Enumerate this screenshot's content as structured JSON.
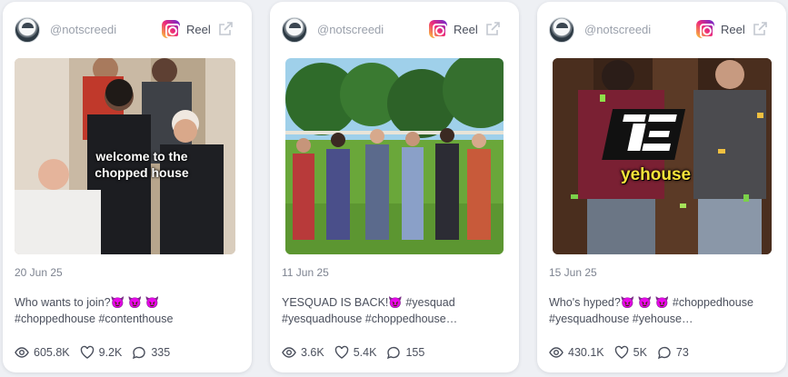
{
  "cards": [
    {
      "handle": "@notscreedi",
      "type": "Reel",
      "overlay": [
        "welcome to the",
        "chopped house"
      ],
      "date": "20 Jun 25",
      "caption": [
        "Who wants to join?😈 😈 😈",
        "#choppedhouse #contenthouse"
      ],
      "views": "605.8K",
      "likes": "9.2K",
      "comments": "335"
    },
    {
      "handle": "@notscreedi",
      "type": "Reel",
      "date": "11 Jun 25",
      "caption": [
        "YESQUAD IS BACK!😈 #yesquad",
        "#yesquadhouse #choppedhouse…"
      ],
      "views": "3.6K",
      "likes": "5.4K",
      "comments": "155"
    },
    {
      "handle": "@notscreedi",
      "type": "Reel",
      "overlay": [
        "yehouse"
      ],
      "date": "15 Jun 25",
      "caption": [
        "Who's hyped?😈 😈 😈 #choppedhouse",
        "#yesquadhouse #yehouse…"
      ],
      "views": "430.1K",
      "likes": "5K",
      "comments": "73"
    }
  ],
  "icons": {
    "platform": "instagram-icon",
    "external": "external-link-icon",
    "views": "eye-icon",
    "likes": "heart-icon",
    "comments": "comment-icon"
  },
  "colors": {
    "background": "#eef0f4",
    "card": "#ffffff",
    "muted_text": "#9aa0ab",
    "body_text": "#4a4f5c"
  }
}
